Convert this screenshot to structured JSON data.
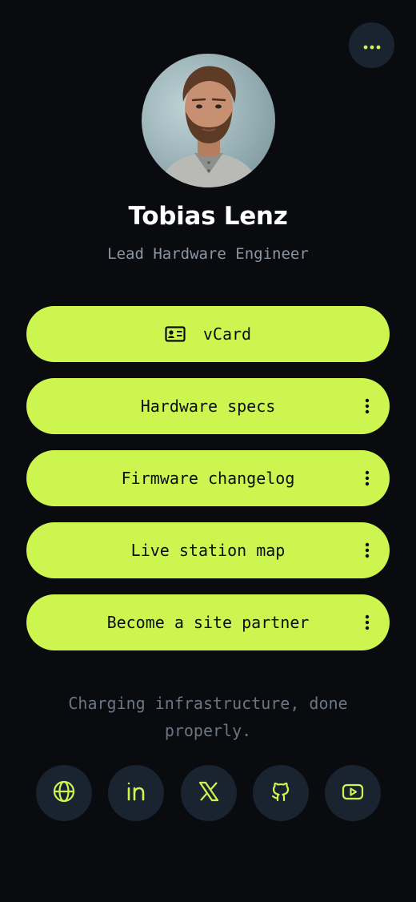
{
  "profile": {
    "name": "Tobias Lenz",
    "title": "Lead Hardware Engineer"
  },
  "links": [
    {
      "label": "vCard",
      "icon": "id-card-icon",
      "has_menu": false
    },
    {
      "label": "Hardware specs",
      "has_menu": true
    },
    {
      "label": "Firmware changelog",
      "has_menu": true
    },
    {
      "label": "Live station map",
      "has_menu": true
    },
    {
      "label": "Become a site partner",
      "has_menu": true
    }
  ],
  "tagline": "Charging infrastructure, done properly.",
  "socials": [
    {
      "icon": "globe-icon"
    },
    {
      "icon": "linkedin-icon"
    },
    {
      "icon": "x-icon"
    },
    {
      "icon": "github-icon"
    },
    {
      "icon": "youtube-icon"
    }
  ],
  "colors": {
    "background": "#090b0f",
    "accent": "#cdf54f",
    "surface": "#1a2430",
    "muted_text": "#8a96a3"
  }
}
